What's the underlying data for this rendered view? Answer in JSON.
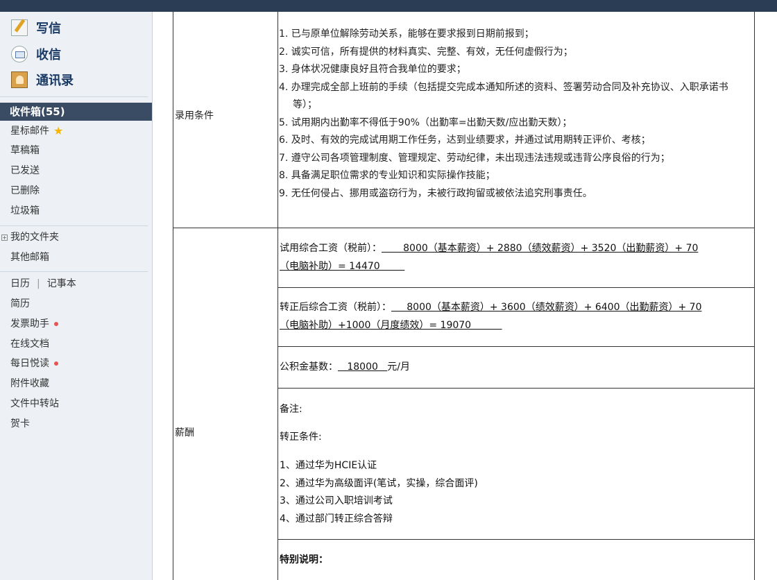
{
  "sidebar": {
    "write": "写信",
    "receive": "收信",
    "contacts": "通讯录",
    "inbox": "收件箱(55)",
    "folders": [
      "星标邮件",
      "草稿箱",
      "已发送",
      "已删除",
      "垃圾箱"
    ],
    "my_folders": "我的文件夹",
    "other_mailbox": "其他邮箱",
    "calendar": "日历",
    "sep": "|",
    "notebook": "记事本",
    "tools": [
      "简历",
      "发票助手",
      "在线文档",
      "每日悦读",
      "附件收藏",
      "文件中转站",
      "贺卡"
    ]
  },
  "table": {
    "employment_label": "录用条件",
    "conditions": [
      "1. 已与原单位解除劳动关系，能够在要求报到日期前报到；",
      "2. 诚实可信，所有提供的材料真实、完整、有效，无任何虚假行为；",
      "3. 身体状况健康良好且符合我单位的要求；",
      "4. 办理完成全部上班前的手续（包括提交完成本通知所述的资料、签署劳动合同及补充协议、入职承诺书等）；",
      "5. 试用期内出勤率不得低于90%（出勤率=出勤天数/应出勤天数）；",
      "6. 及时、有效的完成试用期工作任务，达到业绩要求，并通过试用期转正评价、考核；",
      "7. 遵守公司各项管理制度、管理规定、劳动纪律，未出现违法违规或违背公序良俗的行为；",
      "8. 具备满足职位需求的专业知识和实际操作技能；",
      "9. 无任何侵占、挪用或盗窃行为，未被行政拘留或被依法追究刑事责任。"
    ],
    "salary_label": "薪酬",
    "probation_prefix": "试用综合工资（税前）：",
    "probation_line1": "       8000（基本薪资）+ 2880（绩效薪资）+ 3520（出勤薪资）+ 70",
    "probation_line2": "（电脑补助）= 14470        ",
    "regular_prefix": "转正后综合工资（税前）：",
    "regular_line1": "     8000（基本薪资）+ 3600（绩效薪资）+ 6400（出勤薪资）+ 70",
    "regular_line2": "（电脑补助）+1000（月度绩效）= 19070          ",
    "fund_prefix": "公积金基数：",
    "fund_value": "   18000   ",
    "fund_suffix": "元/月",
    "remark": "备注:",
    "regular_conditions_title": "转正条件:",
    "regular_conditions": [
      "1、通过华为HCIE认证",
      "2、通过华为高级面评(笔试，实操，综合面评)",
      "3、通过公司入职培训考试",
      "4、通过部门转正综合答辩"
    ],
    "special_note": "特别说明："
  }
}
